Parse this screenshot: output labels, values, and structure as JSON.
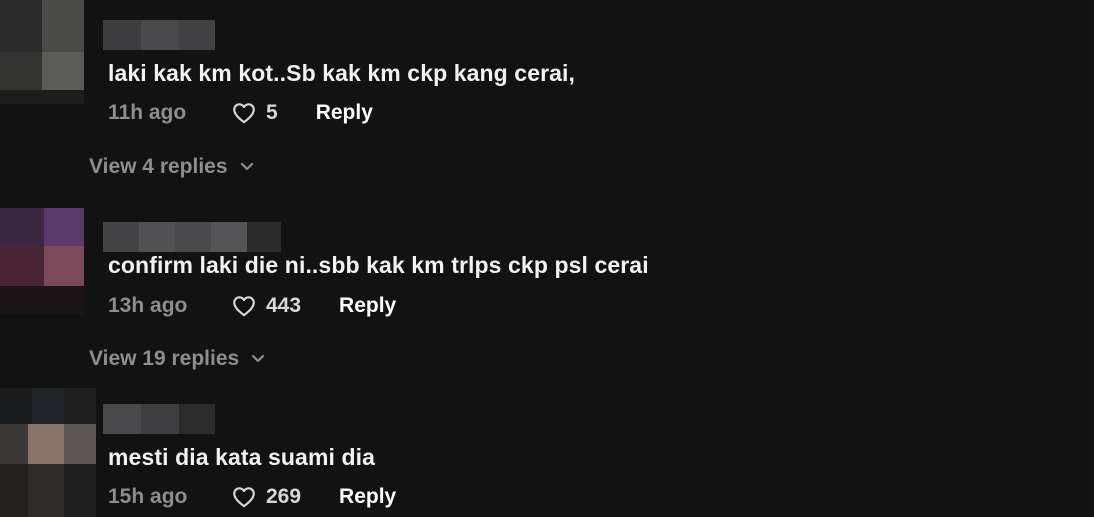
{
  "icons": {
    "like": "heart-outline-icon",
    "expand": "chevron-down-icon"
  },
  "colors": {
    "background": "#121212",
    "text_primary": "#ffffff",
    "text_secondary": "#8e8e8e"
  },
  "comments": [
    {
      "text": "laki kak km kot..Sb kak km ckp kang cerai,",
      "time": "11h ago",
      "likes": "5",
      "reply_label": "Reply",
      "view_replies": "View 4 replies"
    },
    {
      "text": "confirm laki die ni..sbb kak km trlps ckp psl cerai",
      "time": "13h ago",
      "likes": "443",
      "reply_label": "Reply",
      "view_replies": "View 19 replies"
    },
    {
      "text": "mesti dia kata suami dia",
      "time": "15h ago",
      "likes": "269",
      "reply_label": "Reply"
    }
  ]
}
